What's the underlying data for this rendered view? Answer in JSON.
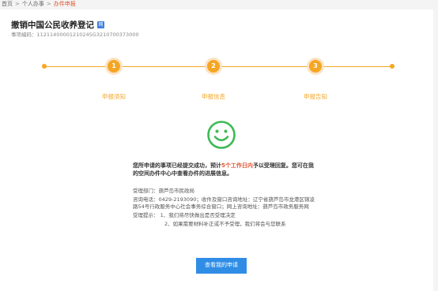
{
  "breadcrumb": {
    "items": [
      "首页",
      "个人办事",
      "办件申报"
    ],
    "separator": ">",
    "current_color": "#e0532f"
  },
  "header": {
    "title": "撤销中国公民收养登记",
    "badge": "网",
    "code_label": "事项编码：",
    "code_value": "11211400001210245G3210700373000"
  },
  "steps": [
    {
      "number": "1",
      "label": "申报须知"
    },
    {
      "number": "2",
      "label": "申报信息"
    },
    {
      "number": "3",
      "label": "申报告知"
    }
  ],
  "result": {
    "icon": "smile-icon",
    "message_pre": "您所申请的事项已经提交成功，预计",
    "message_highlight": "5个工作日内",
    "message_post": "予以受理回复。您可在我的空间办件中心中查看办件的进展信息。",
    "dept": "受理部门：葫芦岛市民政局",
    "contact": "咨询电话：0429-2193090；收件及窗口咨询地址：辽宁省葫芦岛市龙港区锦凌路54号行政服务中心社会事务综合窗口；网上咨询地址：葫芦岛市政务服务网",
    "tip1": "受理提示： 1、我们将尽快做出是否受理决定",
    "tip2": "2、如果需要材料补正或不予受理，我们将会与您联系"
  },
  "actions": {
    "view_button": "查看我的申请"
  },
  "colors": {
    "accent_orange": "#f5a623",
    "success_green": "#3cba54",
    "button_blue": "#2f8de6"
  }
}
